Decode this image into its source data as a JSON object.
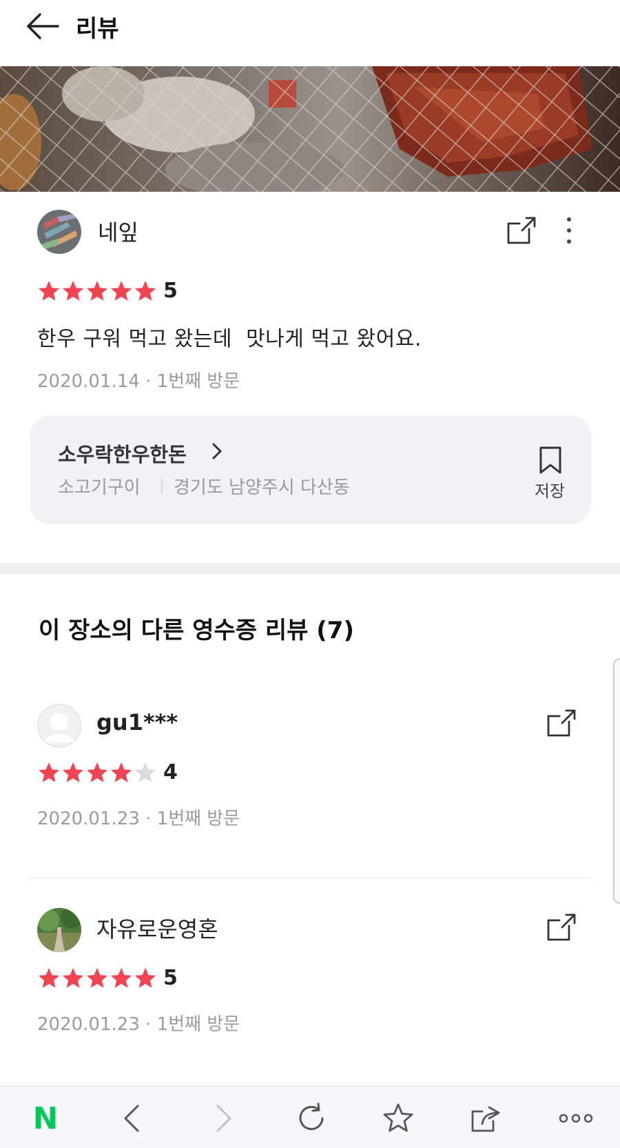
{
  "header": {
    "title": "리뷰"
  },
  "main_review": {
    "reviewer": "네잎",
    "rating": "5",
    "stars_filled": 5,
    "text": "한우 구워 먹고 왔는데  맛나게 먹고 왔어요.",
    "date": "2020.01.14",
    "visit": "1번째 방문",
    "visit_meta": "2020.01.14 · 1번째 방문"
  },
  "place": {
    "name": "소우락한우한돈",
    "category": "소고기구이",
    "address": "경기도 남양주시 다산동",
    "save_label": "저장"
  },
  "other_reviews": {
    "title": "이 장소의 다른 영수증 리뷰 (7)",
    "items": [
      {
        "reviewer": "gu1***",
        "rating": "4",
        "stars_filled": 4,
        "visit_meta": "2020.01.23 · 1번째 방문"
      },
      {
        "reviewer": "자유로운영혼",
        "rating": "5",
        "stars_filled": 5,
        "visit_meta": "2020.01.23 · 1번째 방문"
      }
    ]
  },
  "colors": {
    "star": "#f04452",
    "star_empty": "#dcdcdc",
    "naver_green": "#03c75a"
  },
  "bottom_bar": {
    "icons": [
      "naver-logo",
      "back-icon",
      "forward-icon",
      "refresh-icon",
      "star-icon",
      "share-icon",
      "more-icon"
    ],
    "logo_text": "N"
  }
}
